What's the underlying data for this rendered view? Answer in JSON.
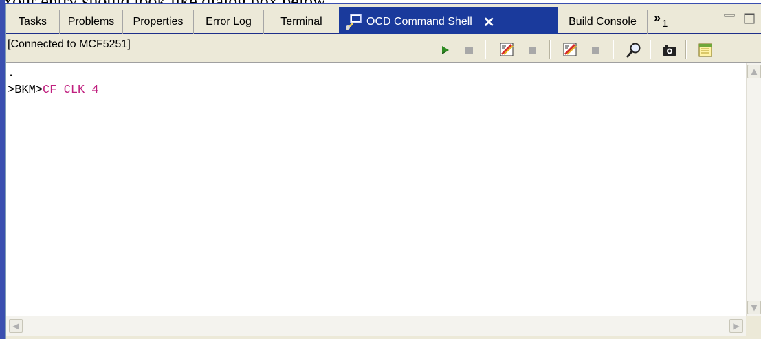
{
  "caption": "Your entry should look like dialog box below.",
  "tabs": [
    {
      "label": "Tasks"
    },
    {
      "label": "Problems"
    },
    {
      "label": "Properties"
    },
    {
      "label": "Error Log"
    },
    {
      "label": "Terminal"
    }
  ],
  "active_tab": {
    "label": "OCD Command Shell",
    "close": "✕"
  },
  "after_tabs": {
    "label": "Build Console"
  },
  "overflow": {
    "chevron": "»",
    "count": "1"
  },
  "status": "[Connected to MCF5251]",
  "console": {
    "lines": [
      {
        "prompt": ".",
        "cmd": ""
      },
      {
        "prompt": ">BKM>",
        "cmd": "CF CLK 4"
      }
    ]
  },
  "colors": {
    "active_tab": "#1a3a9c",
    "command_text": "#c0207f",
    "run_green": "#2e8b22"
  },
  "icons": [
    "ocd-shell-icon",
    "run-icon",
    "stop-icon",
    "edit-icon",
    "search-icon",
    "camera-icon",
    "notes-icon"
  ]
}
